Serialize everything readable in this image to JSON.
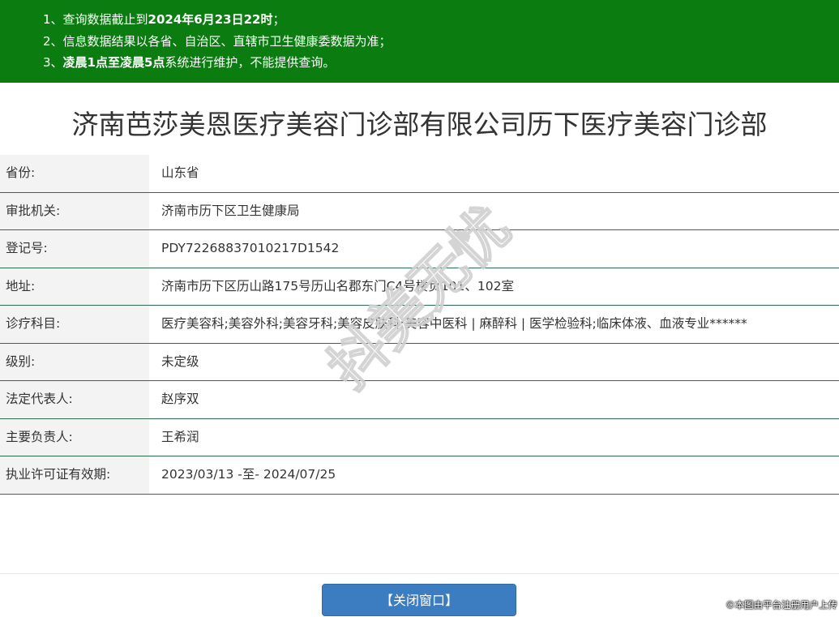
{
  "notice": {
    "line1": {
      "prefix": "1、查询数据截止到",
      "bold": "2024年6月23日22时",
      "suffix": "；"
    },
    "line2": {
      "text": "2、信息数据结果以各省、自治区、直辖市卫生健康委数据为准；"
    },
    "line3": {
      "prefix": "3、",
      "bold": "凌晨1点至凌晨5点",
      "suffix": "系统进行维护，不能提供查询。"
    }
  },
  "title": "济南芭莎美恩医疗美容门诊部有限公司历下医疗美容门诊部",
  "rows": [
    {
      "label": "省份:",
      "value": "山东省"
    },
    {
      "label": "审批机关:",
      "value": "济南市历下区卫生健康局"
    },
    {
      "label": "登记号:",
      "value": "PDY72268837010217D1542"
    },
    {
      "label": "地址:",
      "value": "济南市历下区历山路175号历山名郡东门C4号楼负101、102室"
    },
    {
      "label": "诊疗科目:",
      "value": "医疗美容科;美容外科;美容牙科;美容皮肤科;美容中医科 | 麻醉科 | 医学检验科;临床体液、血液专业******"
    },
    {
      "label": "级别:",
      "value": "未定级"
    },
    {
      "label": "法定代表人:",
      "value": "赵序双"
    },
    {
      "label": "主要负责人:",
      "value": "王希润"
    },
    {
      "label": "执业许可证有效期:",
      "value": "2023/03/13 -至- 2024/07/25"
    }
  ],
  "close_button": {
    "label": "【关闭窗口】"
  },
  "watermark": {
    "text": "抖美无忧"
  },
  "copyright": "©本图由平台注册用户上传",
  "colors": {
    "notice_bg": "#0b7d10",
    "row_border": "#2e6b50",
    "button_bg": "#3c7cc0"
  }
}
